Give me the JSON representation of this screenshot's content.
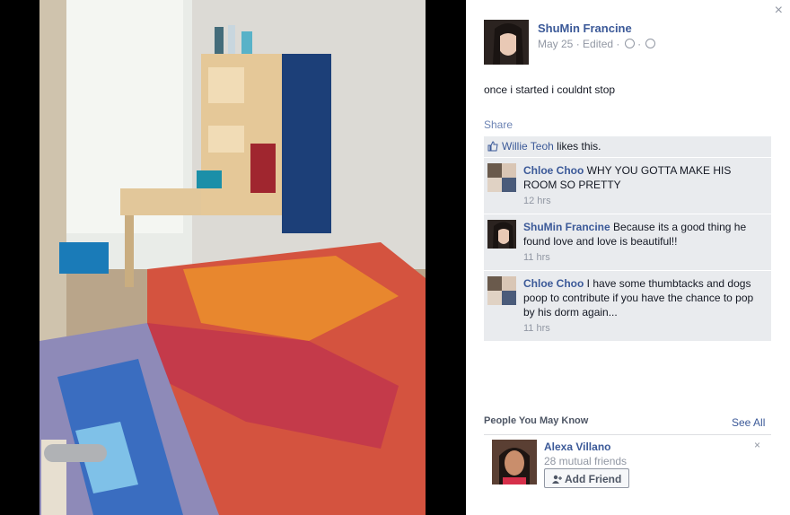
{
  "close_icon": "×",
  "post": {
    "author": "ShuMin Francine",
    "date": "May 25",
    "edited": "· Edited ·",
    "dot": "·",
    "text": "once i started i couldnt stop",
    "share_label": "Share"
  },
  "likes": {
    "name": "Willie Teoh",
    "suffix": " likes this."
  },
  "comments": [
    {
      "author": "Chloe Choo",
      "text": "WHY YOU GOTTA MAKE HIS ROOM SO PRETTY",
      "time": "12 hrs"
    },
    {
      "author": "ShuMin Francine",
      "text": "Because its a good thing he found love and love is beautiful!!",
      "time": "11 hrs"
    },
    {
      "author": "Chloe Choo",
      "text": "I have some thumbtacks and dogs poop to contribute if you have the chance to pop by his dorm again...",
      "time": "11 hrs"
    }
  ],
  "pymk": {
    "title": "People You May Know",
    "see_all": "See All",
    "person": {
      "name": "Alexa Villano",
      "mutual": "28 mutual friends",
      "add_label": "Add Friend",
      "dismiss": "×"
    }
  },
  "colors": {
    "link": "#3b5998",
    "ufi_bg": "#e9ebee",
    "muted": "#9197a3"
  }
}
